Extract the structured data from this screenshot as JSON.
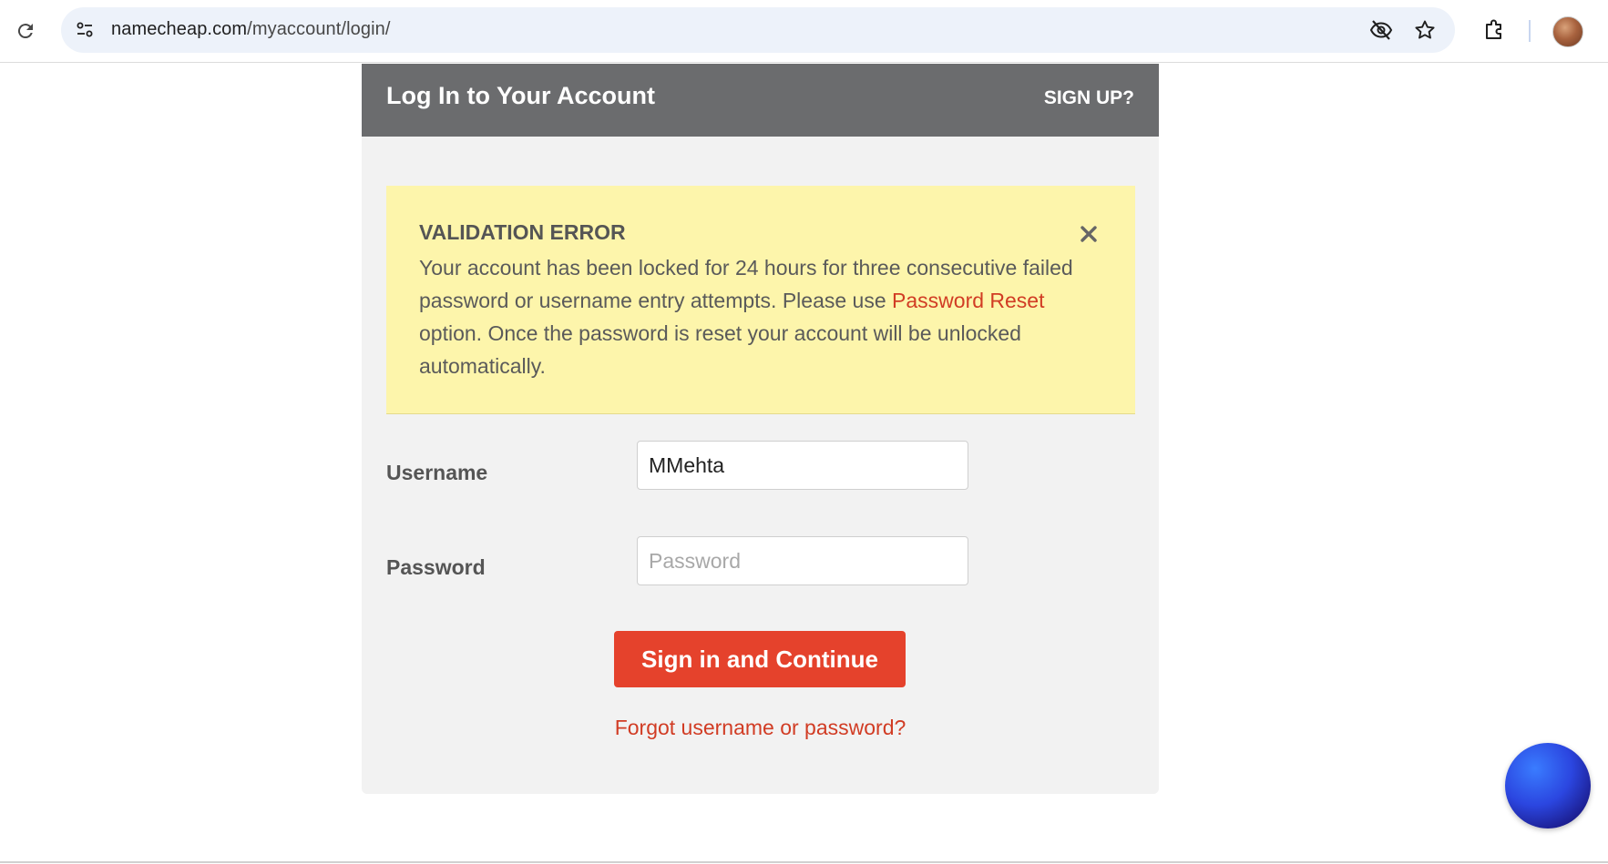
{
  "browser": {
    "url_host": "namecheap.com",
    "url_path": "/myaccount/login/"
  },
  "card": {
    "title": "Log In to Your Account",
    "signup_label": "SIGN UP?"
  },
  "alert": {
    "title": "VALIDATION ERROR",
    "message_before_link": "Your account has been locked for 24 hours for three consecutive failed password or username entry attempts. Please use ",
    "link_text": "Password Reset",
    "message_after_link": " option. Once the password is reset your account will be unlocked automatically."
  },
  "form": {
    "username_label": "Username",
    "username_value": "MMehta",
    "password_label": "Password",
    "password_placeholder": "Password",
    "submit_label": "Sign in and Continue",
    "forgot_label": "Forgot username or password?"
  },
  "colors": {
    "header_bg": "#6b6c6e",
    "alert_bg": "#fdf5ab",
    "accent_red": "#e5422c",
    "link_red": "#d13c24"
  },
  "icons": [
    "reload-icon",
    "site-info-icon",
    "eye-off-icon",
    "star-icon",
    "extensions-icon",
    "close-icon"
  ]
}
